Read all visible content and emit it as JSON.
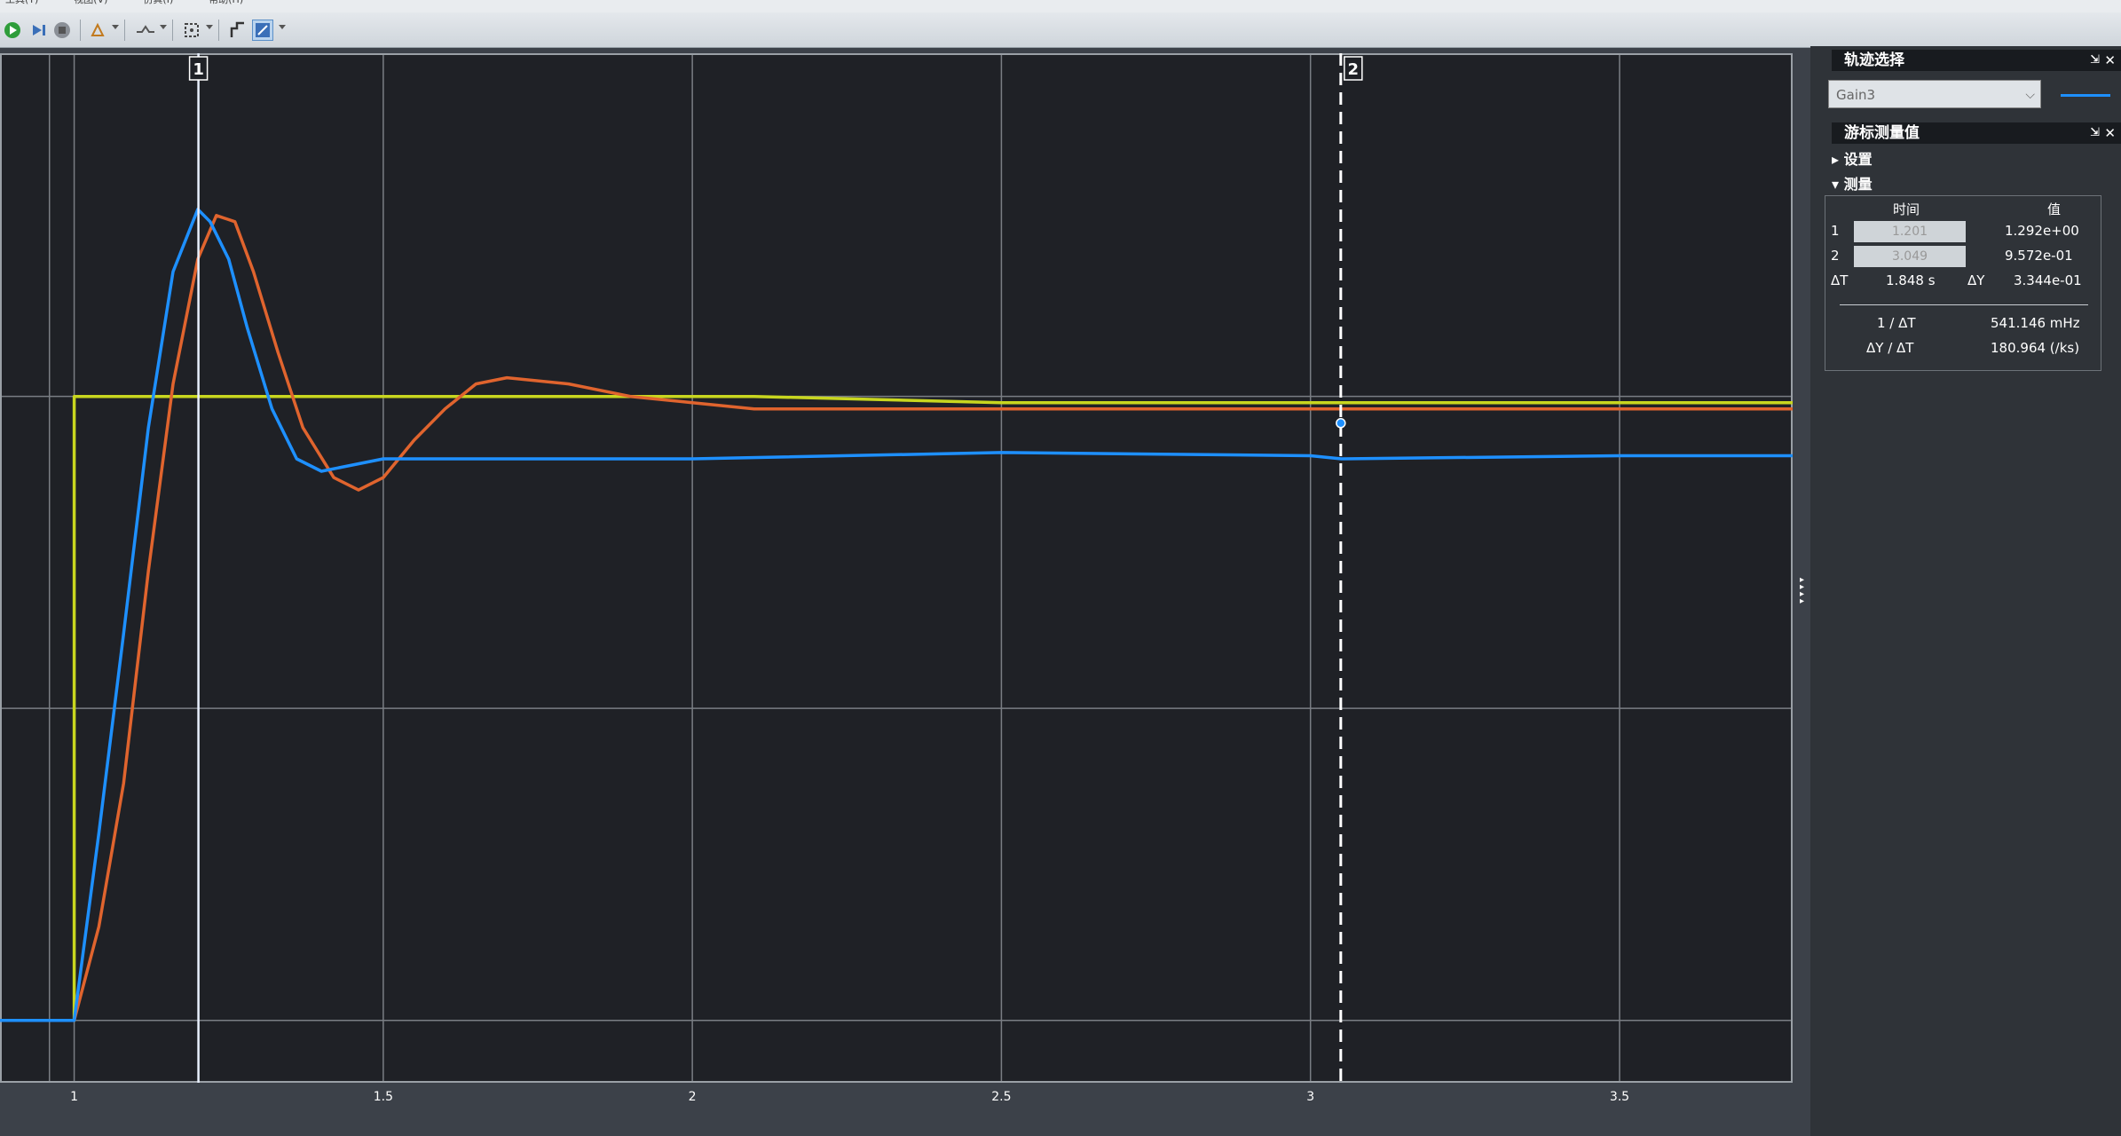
{
  "menu": [
    "工具(T)",
    "视图(V)",
    "仿真(I)",
    "帮助(H)"
  ],
  "toolbar": {
    "buttons": [
      {
        "name": "run-button",
        "icon": "play-icon"
      },
      {
        "name": "step-forward-button",
        "icon": "step-forward-icon"
      },
      {
        "name": "stop-button",
        "icon": "stop-icon"
      },
      {
        "name": "highlight-button",
        "icon": "highlight-icon"
      },
      {
        "name": "triggers-button",
        "icon": "trigger-icon"
      },
      {
        "name": "zoom-fit-button",
        "icon": "fit-to-view-icon"
      },
      {
        "name": "cursor-measurements-button",
        "icon": "cursor-icon"
      },
      {
        "name": "style-button",
        "icon": "pen-icon"
      }
    ]
  },
  "plot": {
    "background": "#1f2126",
    "x_ticks": [
      "1",
      "1.5",
      "2",
      "2.5",
      "3",
      "3.5"
    ],
    "cursor1_label": "1",
    "cursor2_label": "2"
  },
  "chart_data": {
    "type": "line",
    "title": "",
    "xlabel": "",
    "ylabel": "",
    "xlim": [
      0.88,
      3.78
    ],
    "ylim": [
      -0.1,
      1.55
    ],
    "grid": true,
    "series": [
      {
        "color": "#c8d61f",
        "x": [
          0.88,
          1.0,
          1.0,
          2.1,
          2.5,
          3.78
        ],
        "y": [
          0.0,
          0.0,
          1.0,
          1.0,
          0.99,
          0.99
        ]
      },
      {
        "color": "#e0642e",
        "x": [
          0.88,
          1.0,
          1.04,
          1.08,
          1.12,
          1.16,
          1.2,
          1.23,
          1.26,
          1.29,
          1.33,
          1.37,
          1.42,
          1.46,
          1.5,
          1.55,
          1.6,
          1.65,
          1.7,
          1.8,
          1.9,
          2.0,
          2.1,
          2.3,
          2.6,
          3.0,
          3.4,
          3.78
        ],
        "y": [
          0.0,
          0.0,
          0.15,
          0.38,
          0.72,
          1.02,
          1.22,
          1.29,
          1.28,
          1.2,
          1.07,
          0.95,
          0.87,
          0.85,
          0.87,
          0.93,
          0.98,
          1.02,
          1.03,
          1.02,
          1.0,
          0.99,
          0.98,
          0.98,
          0.98,
          0.98,
          0.98,
          0.98
        ]
      },
      {
        "color": "#1e90ff",
        "x": [
          0.88,
          1.0,
          1.04,
          1.08,
          1.12,
          1.16,
          1.2,
          1.22,
          1.25,
          1.28,
          1.32,
          1.36,
          1.4,
          1.45,
          1.5,
          1.6,
          1.8,
          2.0,
          2.5,
          3.0,
          3.05,
          3.5,
          3.78
        ],
        "y": [
          0.0,
          0.0,
          0.3,
          0.62,
          0.95,
          1.2,
          1.3,
          1.28,
          1.22,
          1.11,
          0.98,
          0.9,
          0.88,
          0.89,
          0.9,
          0.9,
          0.9,
          0.9,
          0.91,
          0.905,
          0.9,
          0.905,
          0.905
        ]
      }
    ]
  },
  "panel_signal": {
    "title": "轨迹选择",
    "selected": "Gain3",
    "line_color": "#1e90ff"
  },
  "panel_cursor": {
    "title": "游标测量值",
    "settings_label": "设置",
    "measure_label": "测量",
    "col_time": "时间",
    "col_value": "值",
    "row1_label": "1",
    "row1_time": "1.201",
    "row1_value": "1.292e+00",
    "row2_label": "2",
    "row2_time": "3.049",
    "row2_value": "9.572e-01",
    "dt_label": "ΔT",
    "dt_value": "1.848 s",
    "dy_label": "ΔY",
    "dy_value": "3.344e-01",
    "inv_dt_label": "1 / ΔT",
    "inv_dt_value": "541.146 mHz",
    "dydt_label": "ΔY / ΔT",
    "dydt_value": "180.964 (/ks)"
  }
}
